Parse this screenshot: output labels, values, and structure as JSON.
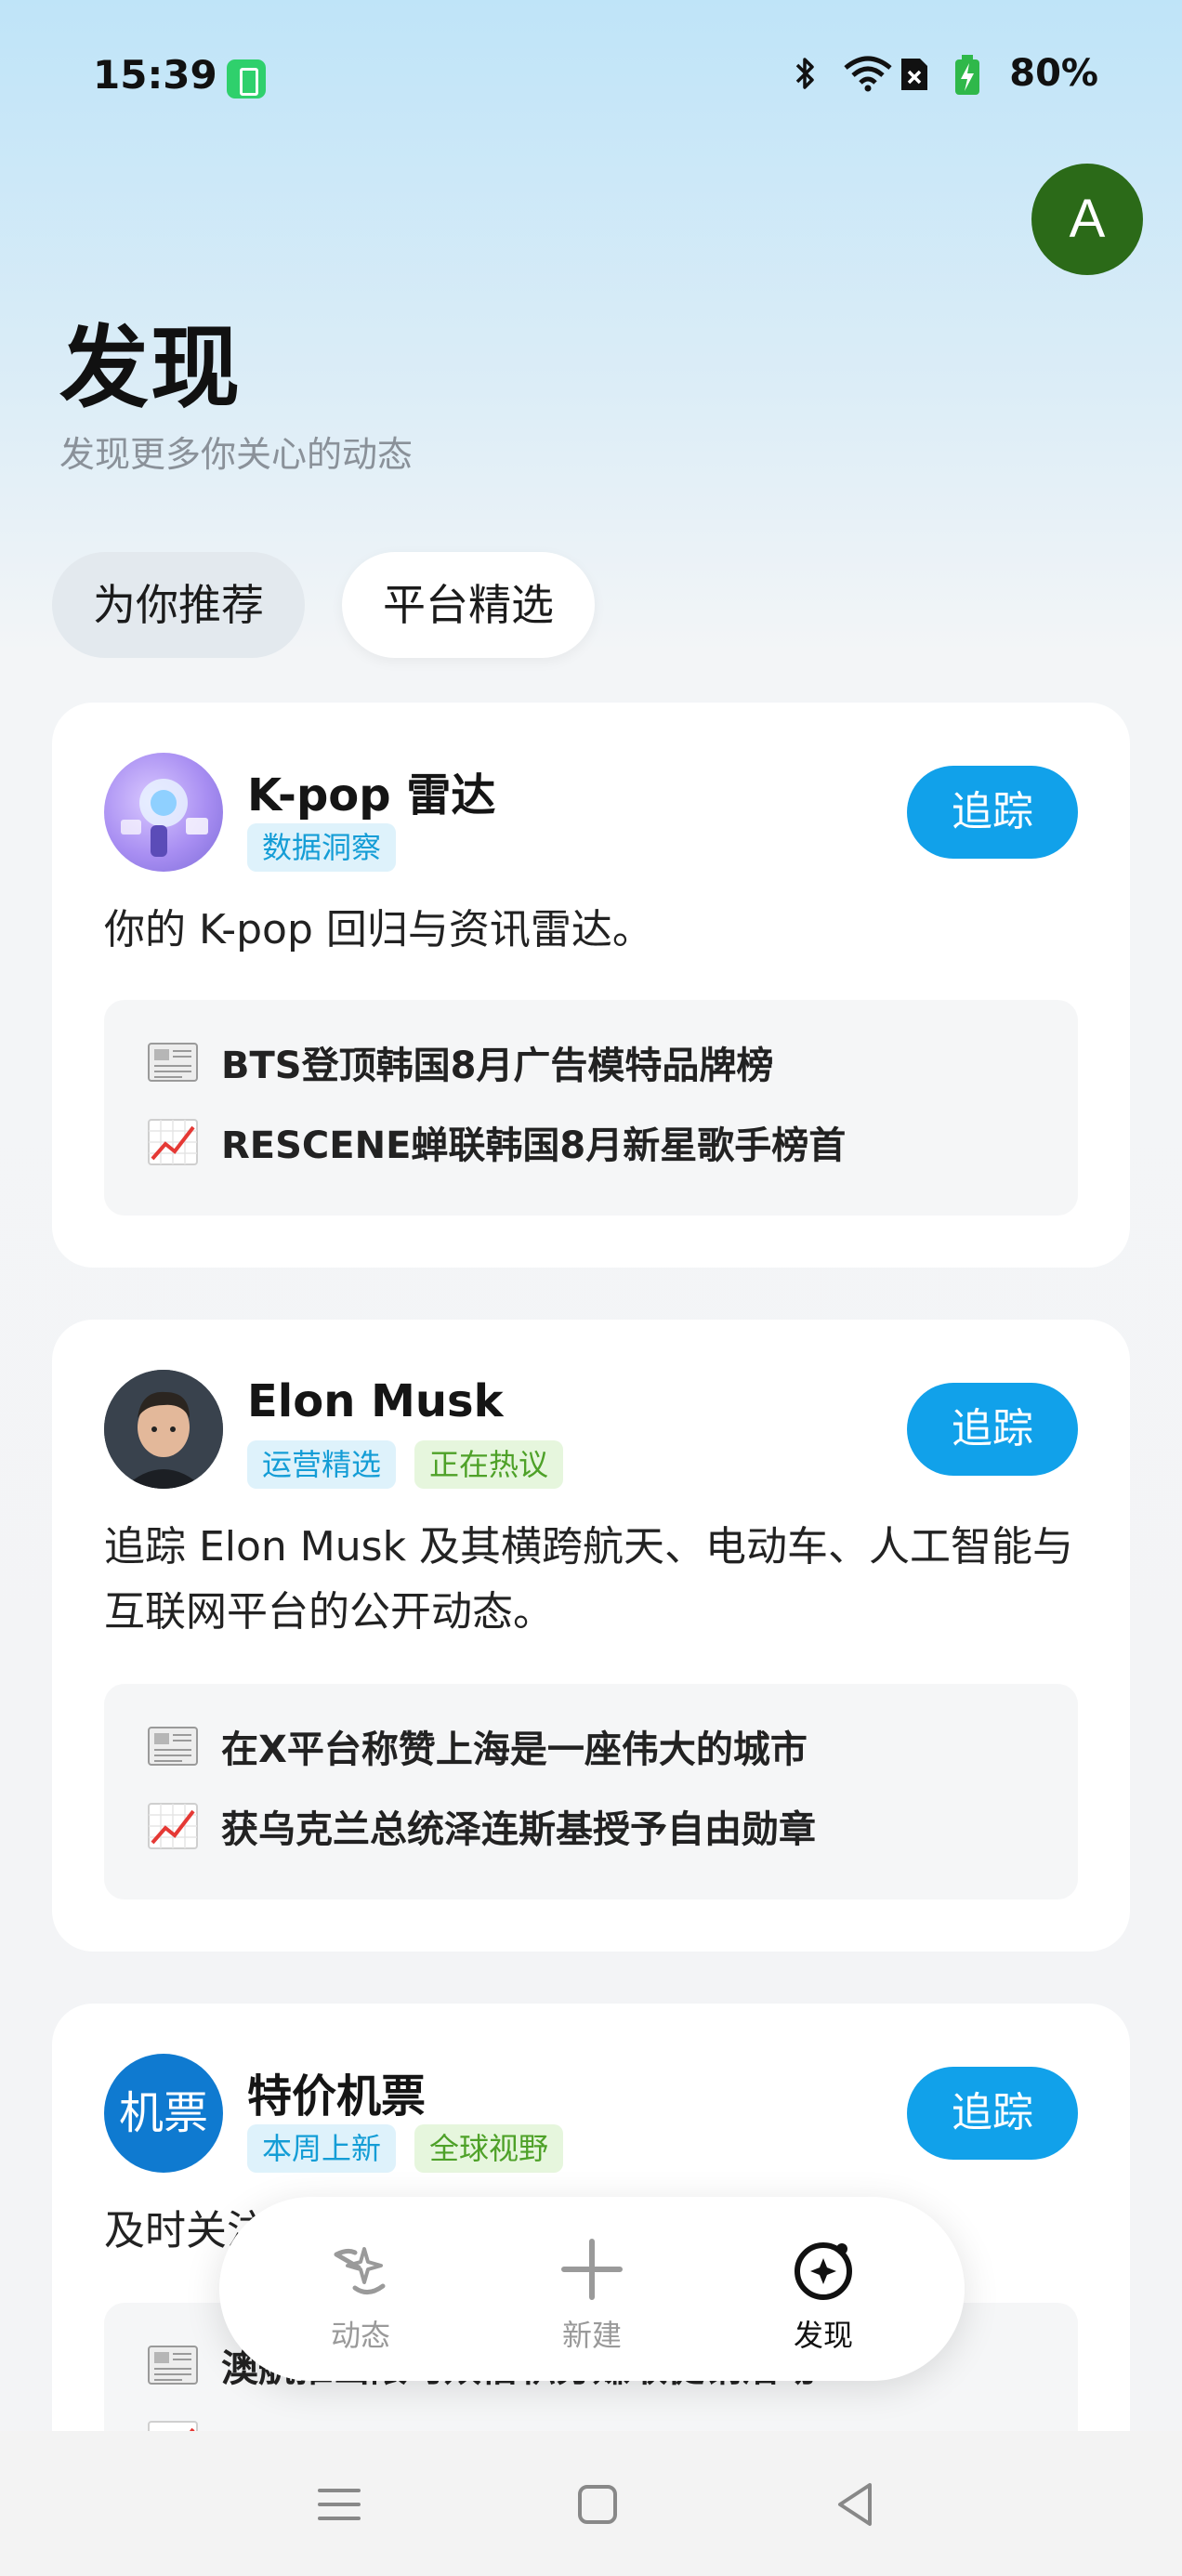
{
  "status_bar": {
    "time": "15:39",
    "battery_percent": "80%",
    "icons": [
      "battery-saver-icon",
      "bluetooth-icon",
      "wifi-icon",
      "no-sim-icon",
      "battery-charging-icon"
    ]
  },
  "profile": {
    "avatar_letter": "A",
    "avatar_color": "#2b6a18"
  },
  "header": {
    "title": "发现",
    "subtitle": "发现更多你关心的动态"
  },
  "tabs": [
    {
      "label": "为你推荐",
      "active": false
    },
    {
      "label": "平台精选",
      "active": true
    }
  ],
  "cards": [
    {
      "title": "K-pop 雷达",
      "tags": [
        {
          "label": "数据洞察",
          "color": "blue"
        }
      ],
      "follow_label": "追踪",
      "description": "你的 K-pop 回归与资讯雷达。",
      "news": [
        {
          "icon": "newspaper-icon",
          "text": "BTS登顶韩国8月广告模特品牌榜"
        },
        {
          "icon": "chart-up-icon",
          "text": "RESCENE蝉联韩国8月新星歌手榜首"
        }
      ]
    },
    {
      "title": "Elon Musk",
      "tags": [
        {
          "label": "运营精选",
          "color": "blue"
        },
        {
          "label": "正在热议",
          "color": "green"
        }
      ],
      "follow_label": "追踪",
      "description": "追踪 Elon Musk 及其横跨航天、电动车、人工智能与互联网平台的公开动态。",
      "news": [
        {
          "icon": "newspaper-icon",
          "text": "在X平台称赞上海是一座伟大的城市"
        },
        {
          "icon": "chart-up-icon",
          "text": "获乌克兰总统泽连斯基授予自由勋章"
        }
      ]
    },
    {
      "title": "特价机票",
      "avatar_text": "机票",
      "tags": [
        {
          "label": "本周上新",
          "color": "blue"
        },
        {
          "label": "全球视野",
          "color": "green"
        }
      ],
      "follow_label": "追踪",
      "description": "及时关注",
      "news": [
        {
          "icon": "newspaper-icon",
          "text": "澳航推出限时双倍积分赚取促销活动"
        },
        {
          "icon": "chart-up-icon",
          "text": ""
        }
      ]
    }
  ],
  "bottom_nav": [
    {
      "label": "动态",
      "icon": "sparkle-arrow-icon",
      "active": false
    },
    {
      "label": "新建",
      "icon": "plus-icon",
      "active": false
    },
    {
      "label": "发现",
      "icon": "compass-sparkle-icon",
      "active": true
    }
  ],
  "colors": {
    "accent": "#11a1ea",
    "tag_blue_text": "#149dd6",
    "tag_green_text": "#4ea128"
  }
}
